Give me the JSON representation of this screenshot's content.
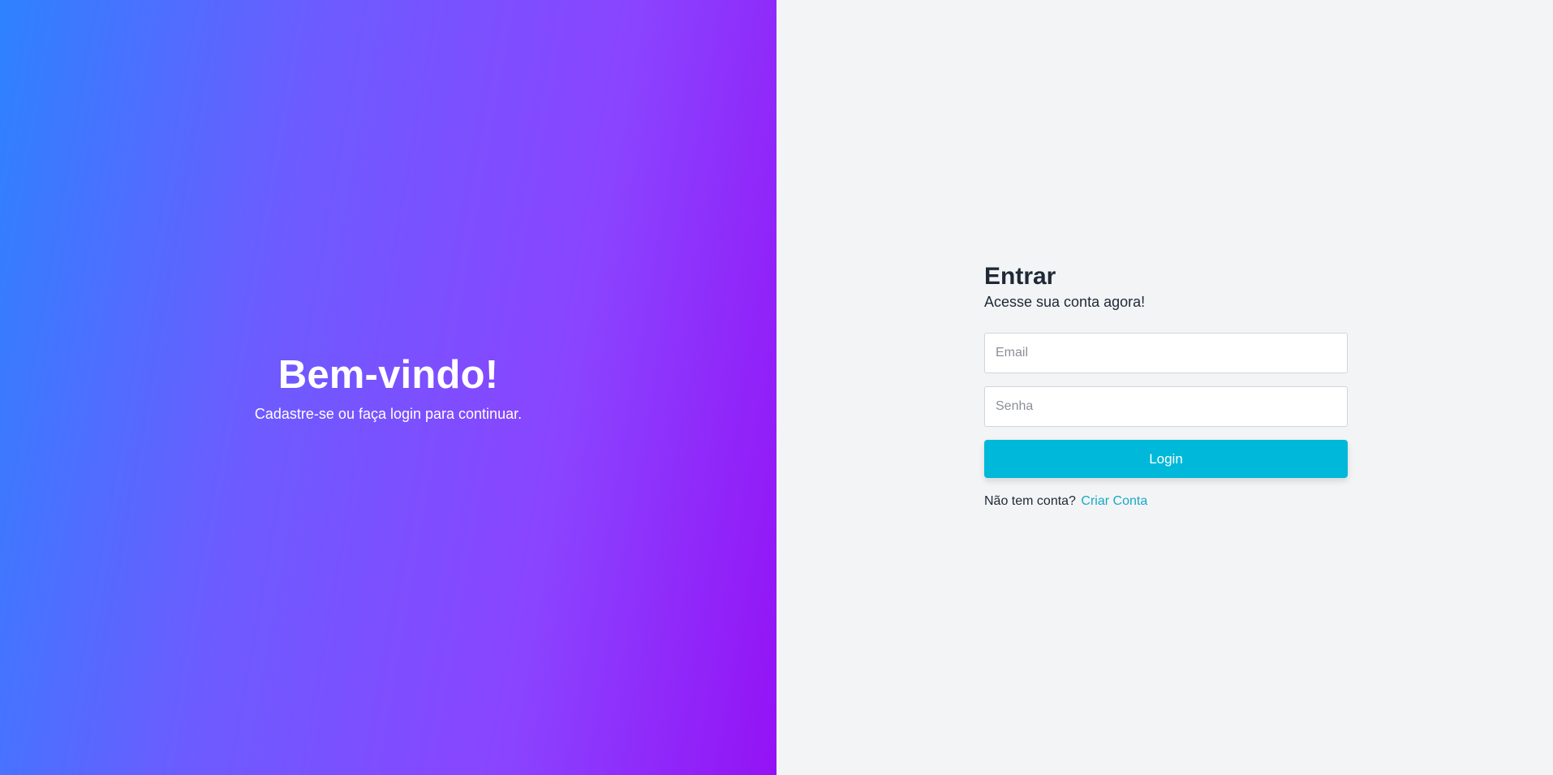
{
  "hero": {
    "title": "Bem-vindo!",
    "subtitle": "Cadastre-se ou faça login para continuar."
  },
  "login": {
    "title": "Entrar",
    "subtitle": "Acesse sua conta agora!",
    "email": {
      "value": "",
      "placeholder": "Email"
    },
    "password": {
      "value": "",
      "placeholder": "Senha"
    },
    "submit_label": "Login",
    "signup_prompt": "Não tem conta?",
    "signup_link": "Criar Conta"
  },
  "colors": {
    "gradient_start": "#2d82ff",
    "gradient_end": "#9412f5",
    "accent": "#00b8d9",
    "background": "#f3f4f6"
  }
}
